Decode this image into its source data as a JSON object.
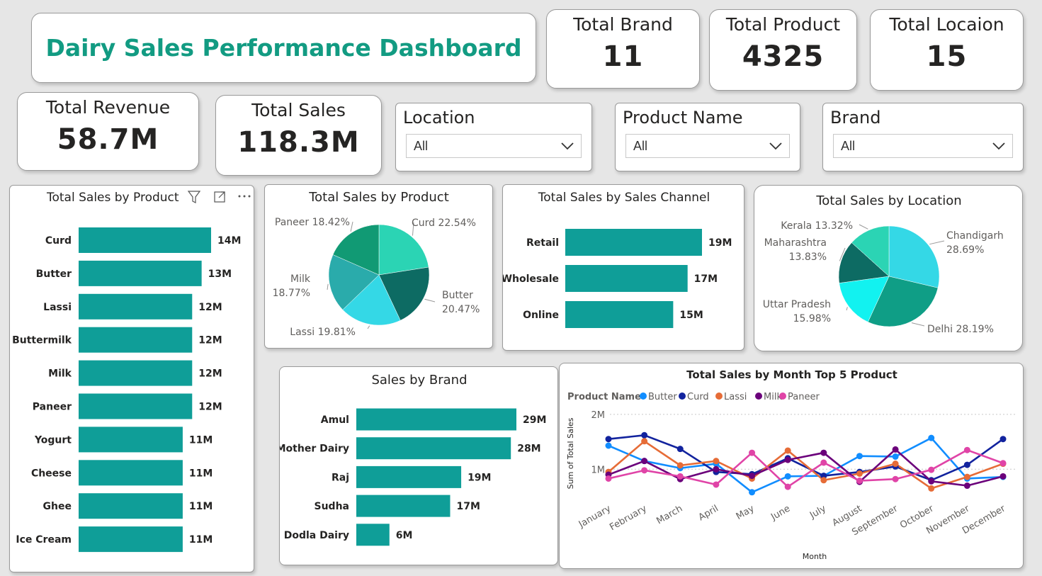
{
  "title": "Dairy Sales Performance Dashboard",
  "kpis": {
    "brand": {
      "label": "Total Brand",
      "value": "11"
    },
    "product": {
      "label": "Total Product",
      "value": "4325"
    },
    "location": {
      "label": "Total Locaion",
      "value": "15"
    },
    "revenue": {
      "label": "Total Revenue",
      "value": "58.7M"
    },
    "sales": {
      "label": "Total Sales",
      "value": "118.3M"
    }
  },
  "slicers": {
    "location": {
      "label": "Location",
      "value": "All"
    },
    "product": {
      "label": "Product Name",
      "value": "All"
    },
    "brand": {
      "label": "Brand",
      "value": "All"
    }
  },
  "colors": {
    "bar": "#0f9e98",
    "accent": "#129b82"
  },
  "chart_data": [
    {
      "type": "bar",
      "orientation": "horizontal",
      "title": "Total Sales by Product",
      "categories": [
        "Curd",
        "Butter",
        "Lassi",
        "Buttermilk",
        "Milk",
        "Paneer",
        "Yogurt",
        "Cheese",
        "Ghee",
        "Ice Cream"
      ],
      "values": [
        14,
        13,
        12,
        12,
        12,
        12,
        11,
        11,
        11,
        11
      ],
      "labels": [
        "14M",
        "13M",
        "12M",
        "12M",
        "12M",
        "12M",
        "11M",
        "11M",
        "11M",
        "11M"
      ],
      "unit": "M"
    },
    {
      "type": "pie",
      "title": "Total Sales by Product",
      "slices": [
        {
          "label": "Curd",
          "value": 22.54,
          "text": "Curd 22.54%",
          "color": "#2bd4b4"
        },
        {
          "label": "Butter",
          "value": 20.47,
          "text1": "Butter",
          "text2": "20.47%",
          "color": "#0d6b63"
        },
        {
          "label": "Lassi",
          "value": 19.81,
          "text": "Lassi 19.81%",
          "color": "#34d8e6"
        },
        {
          "label": "Milk",
          "value": 18.77,
          "text1": "Milk",
          "text2": "18.77%",
          "color": "#2aabab"
        },
        {
          "label": "Paneer",
          "value": 18.42,
          "text": "Paneer 18.42%",
          "color": "#119a74"
        }
      ]
    },
    {
      "type": "bar",
      "orientation": "horizontal",
      "title": "Total Sales by Sales Channel",
      "categories": [
        "Retail",
        "Wholesale",
        "Online"
      ],
      "values": [
        19,
        17,
        15
      ],
      "labels": [
        "19M",
        "17M",
        "15M"
      ],
      "unit": "M"
    },
    {
      "type": "pie",
      "title": "Total Sales by Location",
      "slices": [
        {
          "label": "Chandigarh",
          "value": 28.69,
          "text1": "Chandigarh",
          "text2": "28.69%",
          "color": "#34d8e6"
        },
        {
          "label": "Delhi",
          "value": 28.19,
          "text": "Delhi 28.19%",
          "color": "#0f9e86"
        },
        {
          "label": "Uttar Pradesh",
          "value": 15.98,
          "text1": "Uttar Pradesh",
          "text2": "15.98%",
          "color": "#12f2f0"
        },
        {
          "label": "Maharashtra",
          "value": 13.83,
          "text1": "Maharashtra",
          "text2": "13.83%",
          "color": "#0d6b63"
        },
        {
          "label": "Kerala",
          "value": 13.32,
          "text": "Kerala 13.32%",
          "color": "#2bd4b4"
        }
      ]
    },
    {
      "type": "bar",
      "orientation": "horizontal",
      "title": "Sales by Brand",
      "categories": [
        "Amul",
        "Mother Dairy",
        "Raj",
        "Sudha",
        "Dodla Dairy"
      ],
      "values": [
        29,
        28,
        19,
        17,
        6
      ],
      "labels": [
        "29M",
        "28M",
        "19M",
        "17M",
        "6M"
      ],
      "unit": "M"
    },
    {
      "type": "line",
      "title": "Total Sales by Month Top 5 Product",
      "legend_title": "Product Name",
      "xlabel": "Month",
      "ylabel": "Sum of Total Sales",
      "yticks": [
        "1M",
        "2M"
      ],
      "ylim": [
        0.5,
        2.05
      ],
      "x": [
        "January",
        "February",
        "March",
        "April",
        "May",
        "June",
        "July",
        "August",
        "September",
        "October",
        "November",
        "December"
      ],
      "series": [
        {
          "name": "Butter",
          "color": "#118dff",
          "values": [
            1.43,
            1.15,
            1.02,
            1.1,
            0.58,
            0.87,
            0.88,
            1.24,
            1.23,
            1.57,
            0.83,
            0.86
          ]
        },
        {
          "name": "Curd",
          "color": "#12239e",
          "values": [
            1.55,
            1.62,
            1.37,
            0.95,
            0.91,
            1.2,
            0.88,
            0.95,
            1.05,
            0.8,
            1.08,
            1.55
          ]
        },
        {
          "name": "Lassi",
          "color": "#e66c37",
          "values": [
            0.95,
            1.51,
            1.07,
            1.15,
            0.83,
            1.34,
            0.8,
            0.92,
            1.1,
            0.65,
            0.86,
            1.1
          ]
        },
        {
          "name": "Milk",
          "color": "#6b007b",
          "values": [
            0.9,
            1.15,
            0.82,
            1.0,
            0.88,
            1.17,
            1.3,
            0.77,
            1.36,
            0.78,
            0.7,
            0.87
          ]
        },
        {
          "name": "Paneer",
          "color": "#e044a7",
          "values": [
            0.83,
            0.98,
            0.87,
            0.72,
            1.3,
            0.68,
            1.12,
            0.79,
            0.82,
            0.99,
            1.35,
            1.11
          ]
        }
      ]
    }
  ]
}
